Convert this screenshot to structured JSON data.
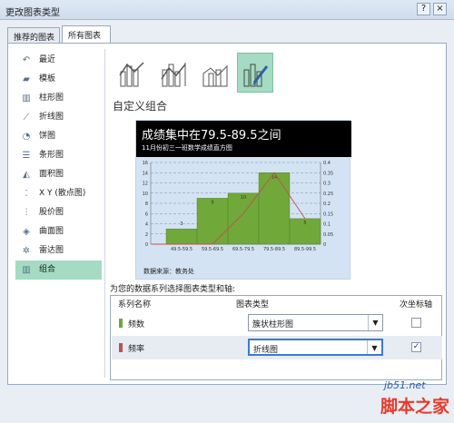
{
  "window": {
    "title": "更改图表类型",
    "help": "?",
    "close": "×"
  },
  "tabs": [
    {
      "label": "推荐的图表"
    },
    {
      "label": "所有图表"
    }
  ],
  "sidebar": {
    "items": [
      {
        "label": "最近",
        "icon": "recent-icon",
        "glyph": "↶"
      },
      {
        "label": "模板",
        "icon": "folder-icon",
        "glyph": "▰"
      },
      {
        "label": "柱形图",
        "icon": "column-chart-icon",
        "glyph": "▥"
      },
      {
        "label": "折线图",
        "icon": "line-chart-icon",
        "glyph": "⟋"
      },
      {
        "label": "饼图",
        "icon": "pie-chart-icon",
        "glyph": "◔"
      },
      {
        "label": "条形图",
        "icon": "bar-chart-icon",
        "glyph": "☰"
      },
      {
        "label": "面积图",
        "icon": "area-chart-icon",
        "glyph": "◭"
      },
      {
        "label": "X Y (散点图)",
        "icon": "scatter-chart-icon",
        "glyph": "⁚"
      },
      {
        "label": "股价图",
        "icon": "stock-chart-icon",
        "glyph": "⫶"
      },
      {
        "label": "曲面图",
        "icon": "surface-chart-icon",
        "glyph": "◈"
      },
      {
        "label": "雷达图",
        "icon": "radar-chart-icon",
        "glyph": "✲"
      },
      {
        "label": "组合",
        "icon": "combo-chart-icon",
        "glyph": "▥"
      }
    ],
    "selected_index": 11
  },
  "main": {
    "section_title": "自定义组合",
    "preview": {
      "title": "成绩集中在79.5-89.5之间",
      "subtitle": "11月份初三一班数学成绩直方图",
      "source": "数据来源：教务处"
    },
    "assign_label": "为您的数据系列选择图表类型和轴:",
    "table": {
      "headers": [
        "系列名称",
        "图表类型",
        "次坐标轴"
      ],
      "rows": [
        {
          "name": "频数",
          "color": "#70a83a",
          "chart_type": "簇状柱形图",
          "secondary_axis": false
        },
        {
          "name": "频率",
          "color": "#c0504d",
          "chart_type": "折线图",
          "secondary_axis": true
        }
      ]
    }
  },
  "chart_data": {
    "type": "bar",
    "title": "成绩集中在79.5-89.5之间",
    "subtitle": "11月份初三一班数学成绩直方图",
    "categories": [
      "49.5-59.5",
      "59.5-69.5",
      "69.5-79.5",
      "79.5-89.5",
      "89.5-99.5"
    ],
    "series": [
      {
        "name": "频数",
        "kind": "bar",
        "axis": "primary",
        "values": [
          3,
          9,
          10,
          14,
          5
        ]
      },
      {
        "name": "频率",
        "kind": "line",
        "axis": "secondary",
        "values": [
          0,
          0,
          0.15,
          0.35,
          0.125
        ]
      }
    ],
    "bar_labels": [
      "3",
      "9",
      "10",
      "14",
      "5"
    ],
    "y_ticks": [
      "0",
      "2",
      "4",
      "6",
      "8",
      "10",
      "12",
      "14",
      "16"
    ],
    "y2_ticks": [
      "0",
      "0.05",
      "0.1",
      "0.15",
      "0.2",
      "0.25",
      "0.3",
      "0.35",
      "0.4"
    ],
    "ylim": [
      0,
      16
    ],
    "y2lim": [
      0,
      0.4
    ],
    "grid": true,
    "colors": {
      "bar": "#70a83a",
      "line": "#c0504d",
      "background": "#d4e3f3"
    }
  },
  "watermark": {
    "line1": "jb51.net",
    "line2": "脚本之家"
  }
}
